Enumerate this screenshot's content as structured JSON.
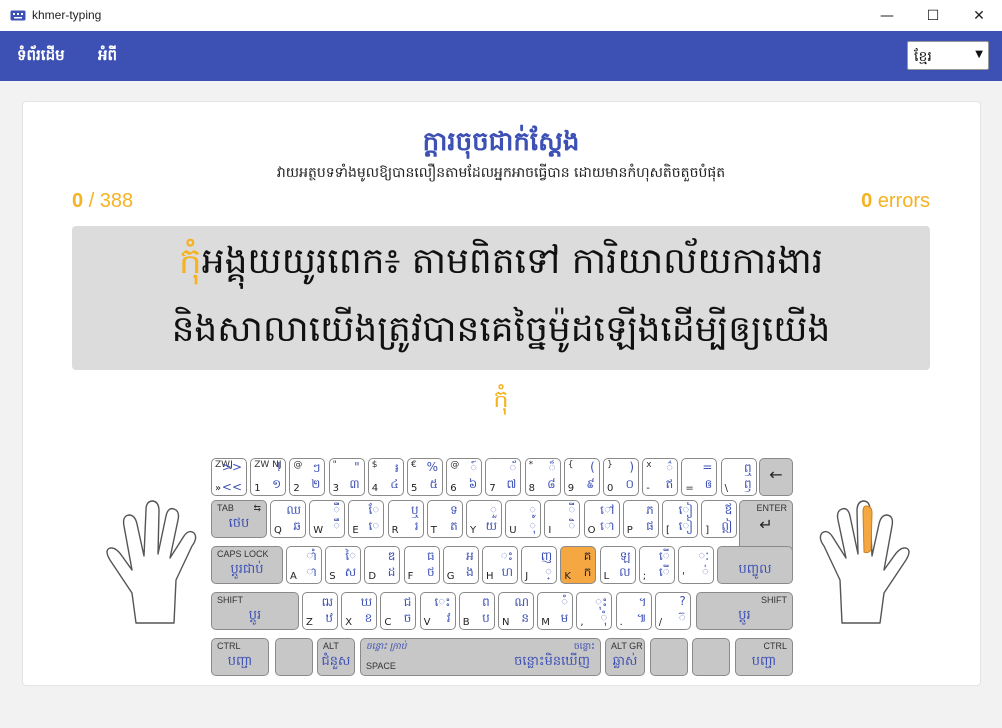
{
  "window": {
    "title": "khmer-typing",
    "minimize": "—",
    "maximize": "☐",
    "close": "✕"
  },
  "nav": {
    "home": "ទំព័រដើម",
    "about": "អំពី",
    "language": "ខ្មែរ",
    "caret": "▼"
  },
  "lesson": {
    "title": "ក្តារចុចជាក់ស្តែង",
    "description": "វាយអត្ថបទទាំងមូលឱ្យបានលឿនតាមដែលអ្នកអាចធ្វើបាន ដោយមានកំហុសតិចតួចបំផុត",
    "progress_current": "0",
    "progress_total": "/ 388",
    "errors_count": "0",
    "errors_label": "errors",
    "line1_current": "កុំ",
    "line1_rest": "អង្គុយយូរពេក៖ តាមពិតទៅ ការិយាល័យការងារ",
    "line2": "និងសាលាយើងត្រូវបានគេច្នៃម៉ូដឡើងដើម្បីឲ្យយើង",
    "char_parts": [
      "ក",
      "ុ",
      "ំ"
    ]
  },
  "keyboard": {
    "rows": [
      [
        {
          "s": "ZWJ",
          "k": "»",
          "t": ">>",
          "b": "<<"
        },
        {
          "s": "ZW NJ",
          "k": "1",
          "t": "!",
          "b": "១"
        },
        {
          "s": "@",
          "k": "2",
          "t": "ៗ",
          "b": "២"
        },
        {
          "s": "\"",
          "k": "3",
          "t": "\"",
          "b": "៣"
        },
        {
          "s": "$",
          "k": "4",
          "t": "៛",
          "b": "៤"
        },
        {
          "s": "€",
          "k": "5",
          "t": "%",
          "b": "៥"
        },
        {
          "s": "@",
          "k": "6",
          "t": "៍",
          "b": "៦"
        },
        {
          "s": "",
          "k": "7",
          "t": "័",
          "b": "៧"
        },
        {
          "s": "*",
          "k": "8",
          "t": "៏",
          "b": "៨"
        },
        {
          "s": "{",
          "k": "9",
          "t": "(",
          "b": "៩"
        },
        {
          "s": "}",
          "k": "0",
          "t": ")",
          "b": "០"
        },
        {
          "s": "x",
          "k": "-",
          "t": "៌",
          "b": "ឥ"
        },
        {
          "s": "",
          "k": "=",
          "t": "=",
          "b": "ឲ"
        },
        {
          "s": "",
          "k": "\\",
          "t": "ឮ",
          "b": "ឭ"
        }
      ],
      [
        {
          "s": "",
          "k": "Q",
          "t": "ឈ",
          "b": "ឆ"
        },
        {
          "s": "",
          "k": "W",
          "t": "ឺ",
          "b": "ឹ"
        },
        {
          "s": "",
          "k": "E",
          "t": "ែ",
          "b": "េ"
        },
        {
          "s": "",
          "k": "R",
          "t": "ឬ",
          "b": "រ"
        },
        {
          "s": "",
          "k": "T",
          "t": "ទ",
          "b": "ត"
        },
        {
          "s": "",
          "k": "Y",
          "t": "ួ",
          "b": "យ"
        },
        {
          "s": "",
          "k": "U",
          "t": "ូ",
          "b": "ុ"
        },
        {
          "s": "",
          "k": "I",
          "t": "ី",
          "b": "ិ"
        },
        {
          "s": "",
          "k": "O",
          "t": "ៅ",
          "b": "ោ"
        },
        {
          "s": "",
          "k": "P",
          "t": "ភ",
          "b": "ផ"
        },
        {
          "s": "",
          "k": "[",
          "t": "ៀ",
          "b": "ៀ"
        },
        {
          "s": "",
          "k": "]",
          "t": "ឪ",
          "b": "ឦ"
        }
      ],
      [
        {
          "s": "",
          "k": "A",
          "t": "ាំ",
          "b": "ា"
        },
        {
          "s": "",
          "k": "S",
          "t": "ៃ",
          "b": "ស"
        },
        {
          "s": "",
          "k": "D",
          "t": "ឌ",
          "b": "ដ"
        },
        {
          "s": "",
          "k": "F",
          "t": "ធ",
          "b": "ថ"
        },
        {
          "s": "",
          "k": "G",
          "t": "អ",
          "b": "ង"
        },
        {
          "s": "",
          "k": "H",
          "t": "ះ",
          "b": "ហ"
        },
        {
          "s": "",
          "k": "J",
          "t": "ញ",
          "b": "្"
        },
        {
          "s": "",
          "k": "K",
          "t": "គ",
          "b": "ក"
        },
        {
          "s": "",
          "k": "L",
          "t": "ឡ",
          "b": "ល"
        },
        {
          "s": "",
          "k": ";",
          "t": "ើ",
          "b": "ើ"
        },
        {
          "s": "",
          "k": "'",
          "t": "ៈ",
          "b": "់"
        }
      ],
      [
        {
          "s": "",
          "k": "Z",
          "t": "ឍ",
          "b": "ឋ"
        },
        {
          "s": "",
          "k": "X",
          "t": "ឃ",
          "b": "ខ"
        },
        {
          "s": "",
          "k": "C",
          "t": "ជ",
          "b": "ច"
        },
        {
          "s": "",
          "k": "V",
          "t": "េះ",
          "b": "វ"
        },
        {
          "s": "",
          "k": "B",
          "t": "ព",
          "b": "ប"
        },
        {
          "s": "",
          "k": "N",
          "t": "ណ",
          "b": "ន"
        },
        {
          "s": "",
          "k": "M",
          "t": "ំ",
          "b": "ម"
        },
        {
          "s": "",
          "k": ",",
          "t": "ុះ",
          "b": "ុំ"
        },
        {
          "s": "",
          "k": ".",
          "t": "។",
          "b": "៕"
        },
        {
          "s": "",
          "k": "/",
          "t": "?",
          "b": "៊"
        }
      ]
    ],
    "special": {
      "backspace": "←",
      "tab_label": "TAB",
      "tab_kh": "ថេប",
      "tab_sym": "⇆",
      "enter_label": "ENTER",
      "enter_kh": "បញ្ចូល",
      "enter_sym": "↵",
      "caps_label": "CAPS LOCK",
      "caps_kh": "ប្តូរជាប់",
      "shift_label": "SHIFT",
      "shift_kh": "ប្តូរ",
      "ctrl_label": "CTRL",
      "ctrl_kh": "បញ្ជា",
      "alt_label": "ALT",
      "alt_kh": "ជំនួស",
      "space_label": "SPACE",
      "space_top_left": "ចន្លោះ ក្រាប់",
      "space_top_right": "ចន្លោះ",
      "space_kh": "ចន្លោះមិនឃើញ",
      "altgr_label": "ALT GR",
      "altgr_kh": "ឆ្លាស់"
    },
    "highlighted_key": "K"
  },
  "colors": {
    "accent": "#3d51b5",
    "highlight": "#f5a742",
    "progress": "#f5b221"
  }
}
